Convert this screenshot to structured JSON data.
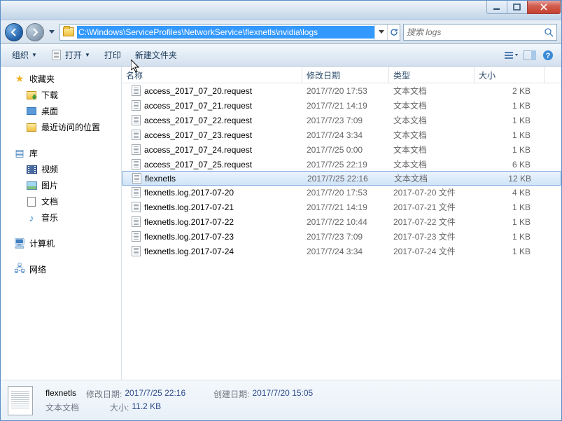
{
  "address_path": "C:\\Windows\\ServiceProfiles\\NetworkService\\flexnetls\\nvidia\\logs",
  "search_placeholder": "搜索 logs",
  "toolbar": {
    "organize": "组织",
    "open": "打开",
    "print": "打印",
    "new_folder": "新建文件夹"
  },
  "sidebar": {
    "favorites": {
      "label": "收藏夹",
      "items": [
        {
          "label": "下载"
        },
        {
          "label": "桌面"
        },
        {
          "label": "最近访问的位置"
        }
      ]
    },
    "libraries": {
      "label": "库",
      "items": [
        {
          "label": "视频"
        },
        {
          "label": "图片"
        },
        {
          "label": "文档"
        },
        {
          "label": "音乐"
        }
      ]
    },
    "computer": {
      "label": "计算机"
    },
    "network": {
      "label": "网络"
    }
  },
  "columns": {
    "name": "名称",
    "date": "修改日期",
    "type": "类型",
    "size": "大小"
  },
  "files": [
    {
      "name": "access_2017_07_20.request",
      "date": "2017/7/20 17:53",
      "type": "文本文档",
      "size": "2 KB"
    },
    {
      "name": "access_2017_07_21.request",
      "date": "2017/7/21 14:19",
      "type": "文本文档",
      "size": "1 KB"
    },
    {
      "name": "access_2017_07_22.request",
      "date": "2017/7/23 7:09",
      "type": "文本文档",
      "size": "1 KB"
    },
    {
      "name": "access_2017_07_23.request",
      "date": "2017/7/24 3:34",
      "type": "文本文档",
      "size": "1 KB"
    },
    {
      "name": "access_2017_07_24.request",
      "date": "2017/7/25 0:00",
      "type": "文本文档",
      "size": "1 KB"
    },
    {
      "name": "access_2017_07_25.request",
      "date": "2017/7/25 22:19",
      "type": "文本文档",
      "size": "6 KB"
    },
    {
      "name": "flexnetls",
      "date": "2017/7/25 22:16",
      "type": "文本文档",
      "size": "12 KB",
      "selected": true
    },
    {
      "name": "flexnetls.log.2017-07-20",
      "date": "2017/7/20 17:53",
      "type": "2017-07-20 文件",
      "size": "4 KB"
    },
    {
      "name": "flexnetls.log.2017-07-21",
      "date": "2017/7/21 14:19",
      "type": "2017-07-21 文件",
      "size": "1 KB"
    },
    {
      "name": "flexnetls.log.2017-07-22",
      "date": "2017/7/22 10:44",
      "type": "2017-07-22 文件",
      "size": "1 KB"
    },
    {
      "name": "flexnetls.log.2017-07-23",
      "date": "2017/7/23 7:09",
      "type": "2017-07-23 文件",
      "size": "1 KB"
    },
    {
      "name": "flexnetls.log.2017-07-24",
      "date": "2017/7/24 3:34",
      "type": "2017-07-24 文件",
      "size": "1 KB"
    }
  ],
  "details": {
    "name": "flexnetls",
    "type": "文本文档",
    "mod_label": "修改日期:",
    "mod_val": "2017/7/25 22:16",
    "size_label": "大小:",
    "size_val": "11.2 KB",
    "created_label": "创建日期:",
    "created_val": "2017/7/20 15:05"
  }
}
